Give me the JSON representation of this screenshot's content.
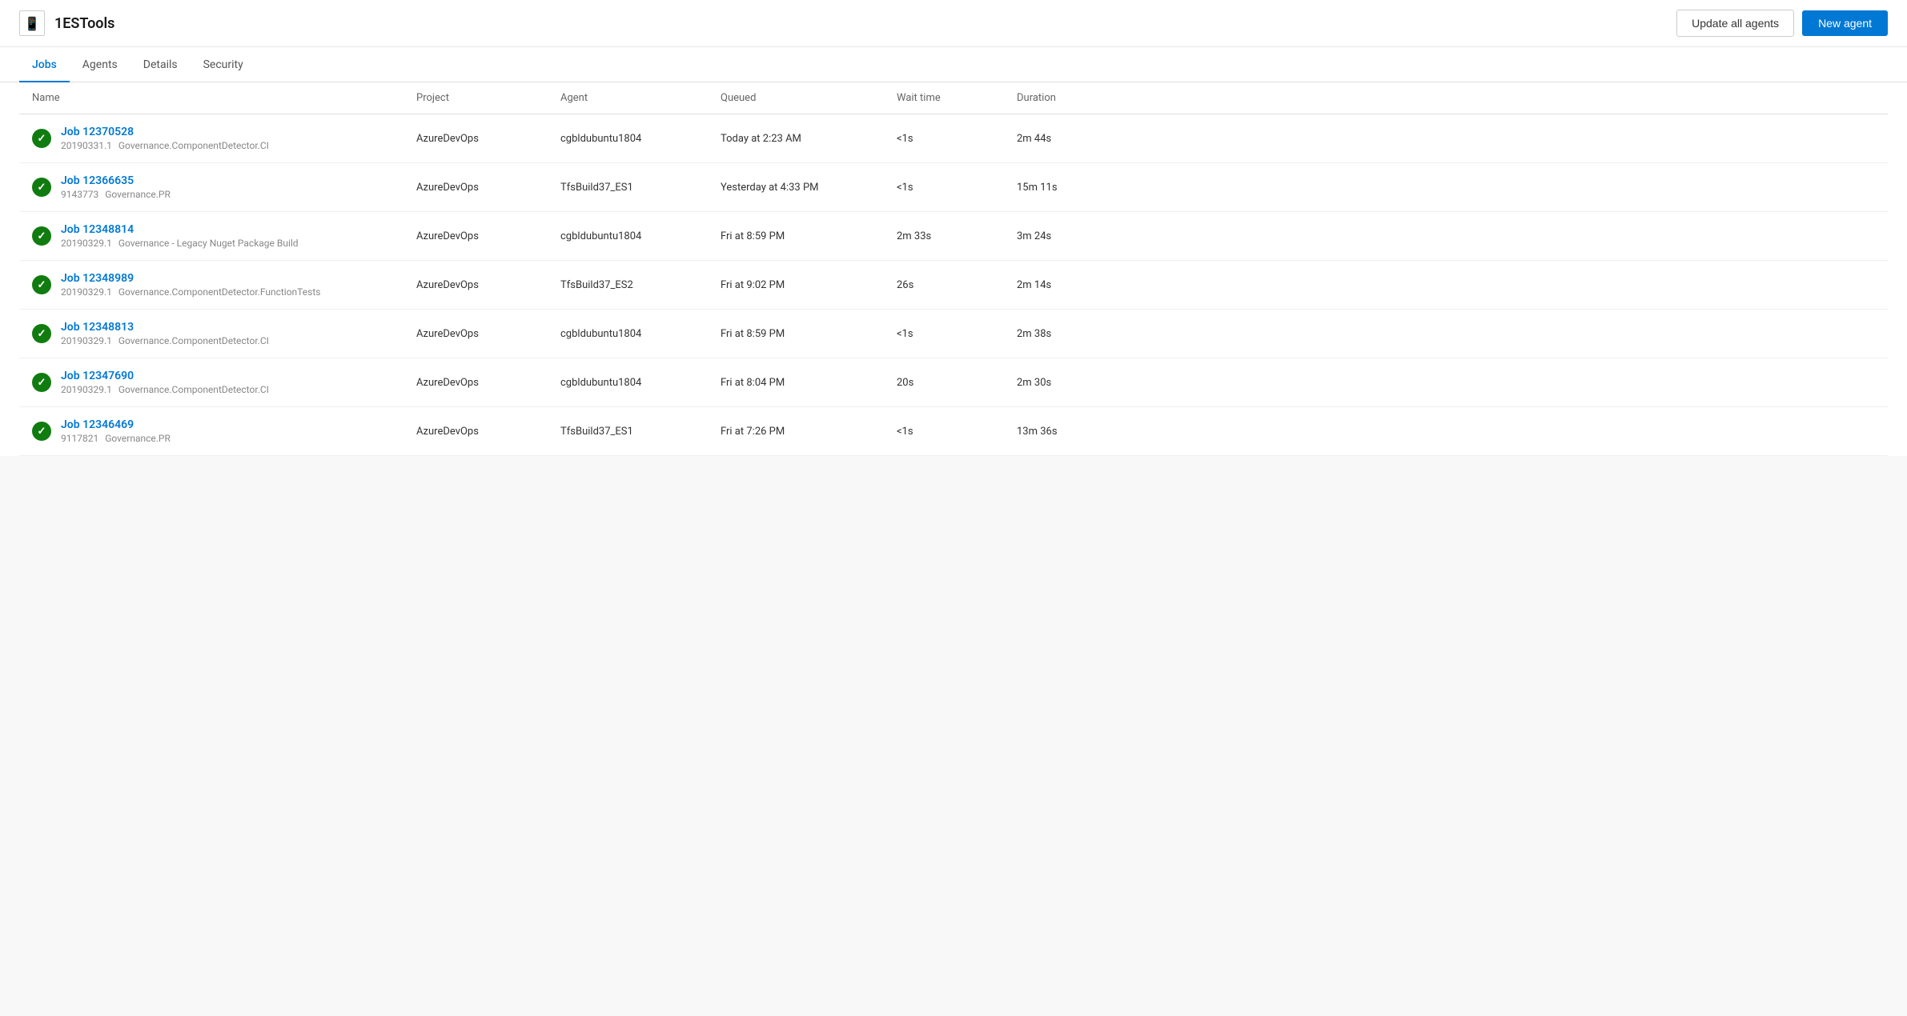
{
  "app": {
    "icon": "📱",
    "title": "1ESTools"
  },
  "header": {
    "update_button": "Update all agents",
    "new_button": "New agent"
  },
  "tabs": [
    {
      "id": "jobs",
      "label": "Jobs",
      "active": true
    },
    {
      "id": "agents",
      "label": "Agents",
      "active": false
    },
    {
      "id": "details",
      "label": "Details",
      "active": false
    },
    {
      "id": "security",
      "label": "Security",
      "active": false
    }
  ],
  "table": {
    "columns": [
      "Name",
      "Project",
      "Agent",
      "Queued",
      "Wait time",
      "Duration"
    ],
    "rows": [
      {
        "id": "job-12370528",
        "title": "Job 12370528",
        "sub1": "20190331.1",
        "sub2": "Governance.ComponentDetector.CI",
        "project": "AzureDevOps",
        "agent": "cgbldubuntu1804",
        "queued": "Today at 2:23 AM",
        "wait_time": "<1s",
        "duration": "2m 44s"
      },
      {
        "id": "job-12366635",
        "title": "Job 12366635",
        "sub1": "9143773",
        "sub2": "Governance.PR",
        "project": "AzureDevOps",
        "agent": "TfsBuild37_ES1",
        "queued": "Yesterday at 4:33 PM",
        "wait_time": "<1s",
        "duration": "15m 11s"
      },
      {
        "id": "job-12348814",
        "title": "Job 12348814",
        "sub1": "20190329.1",
        "sub2": "Governance - Legacy Nuget Package Build",
        "project": "AzureDevOps",
        "agent": "cgbldubuntu1804",
        "queued": "Fri at 8:59 PM",
        "wait_time": "2m 33s",
        "duration": "3m 24s"
      },
      {
        "id": "job-12348989",
        "title": "Job 12348989",
        "sub1": "20190329.1",
        "sub2": "Governance.ComponentDetector.FunctionTests",
        "project": "AzureDevOps",
        "agent": "TfsBuild37_ES2",
        "queued": "Fri at 9:02 PM",
        "wait_time": "26s",
        "duration": "2m 14s"
      },
      {
        "id": "job-12348813",
        "title": "Job 12348813",
        "sub1": "20190329.1",
        "sub2": "Governance.ComponentDetector.CI",
        "project": "AzureDevOps",
        "agent": "cgbldubuntu1804",
        "queued": "Fri at 8:59 PM",
        "wait_time": "<1s",
        "duration": "2m 38s"
      },
      {
        "id": "job-12347690",
        "title": "Job 12347690",
        "sub1": "20190329.1",
        "sub2": "Governance.ComponentDetector.CI",
        "project": "AzureDevOps",
        "agent": "cgbldubuntu1804",
        "queued": "Fri at 8:04 PM",
        "wait_time": "20s",
        "duration": "2m 30s"
      },
      {
        "id": "job-12346469",
        "title": "Job 12346469",
        "sub1": "9117821",
        "sub2": "Governance.PR",
        "project": "AzureDevOps",
        "agent": "TfsBuild37_ES1",
        "queued": "Fri at 7:26 PM",
        "wait_time": "<1s",
        "duration": "13m 36s"
      }
    ]
  }
}
